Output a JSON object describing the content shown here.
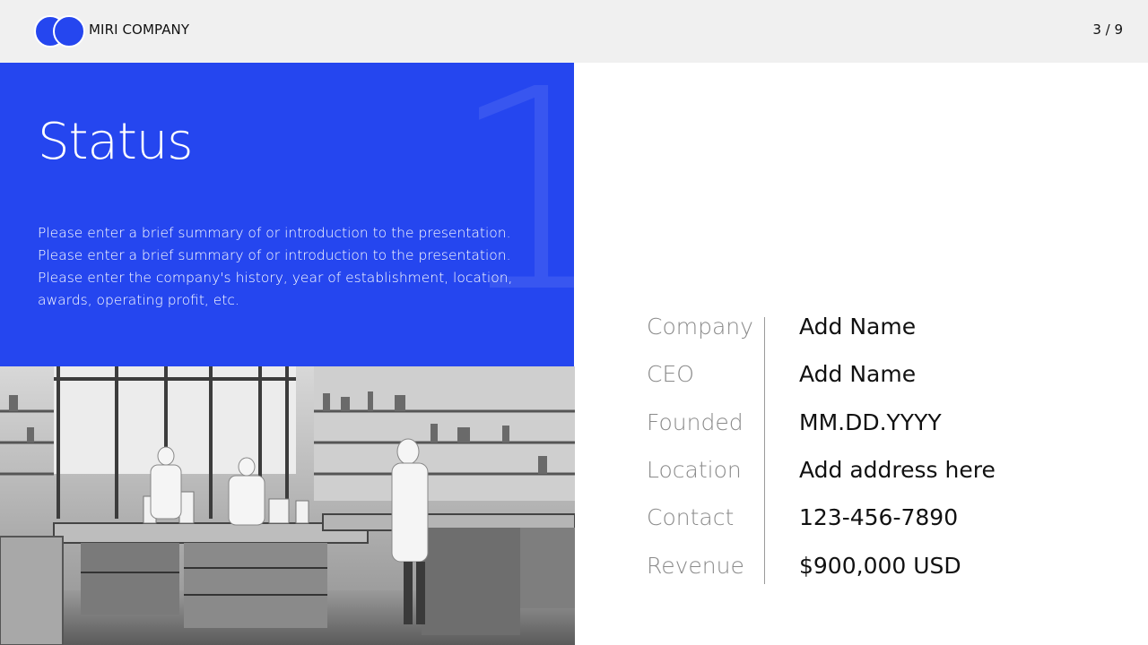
{
  "header": {
    "company": "MIRI COMPANY",
    "page": "3 / 9",
    "brand_color": "#2546ef"
  },
  "slide": {
    "title": "Status",
    "number": "1",
    "summary_lines": [
      "Please enter a brief summary of or introduction to the presentation.",
      "Please enter a brief summary of or introduction to the presentation.",
      "Please enter the company's history, year of establishment, location,",
      "awards, operating profit, etc."
    ]
  },
  "info": [
    {
      "label": "Company",
      "value": "Add Name"
    },
    {
      "label": "CEO",
      "value": "Add Name"
    },
    {
      "label": "Founded",
      "value": "MM.DD.YYYY"
    },
    {
      "label": "Location",
      "value": "Add address here"
    },
    {
      "label": "Contact",
      "value": "123-456-7890"
    },
    {
      "label": "Revenue",
      "value": "$900,000 USD"
    }
  ]
}
